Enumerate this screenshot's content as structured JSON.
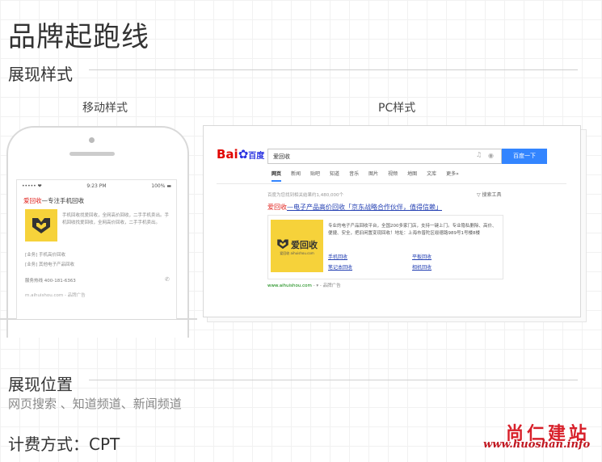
{
  "page": {
    "title": "品牌起跑线"
  },
  "sections": {
    "display_style": {
      "title": "展现样式"
    },
    "display_position": {
      "title": "展现位置",
      "value": "网页搜索 、知道频道、新闻频道"
    },
    "billing": {
      "label": "计费方式：CPT"
    }
  },
  "captions": {
    "mobile": "移动样式",
    "pc": "PC样式"
  },
  "mobile_preview": {
    "status_left": "••••• ❤",
    "time": "9:23 PM",
    "battery": "100% ▬",
    "ad_title_brand": "爱回收",
    "ad_title_rest": "—专注手机回收",
    "description": "手机回收找爱回收，全网高价回收，二手手机卖出。手机回收找爱回收，全网高价回收，二手手机卖出。",
    "link1": "[业务]  手机高价回收",
    "link2": "[业务]  其他电子产品回收",
    "phone": "服务热线  400-181-6363",
    "url": "m.aihuishou.com - 品牌广告"
  },
  "pc_preview": {
    "logo_red": "Bai",
    "logo_blue": "du",
    "logo_cn": "百度",
    "search_value": "爱回收",
    "search_button": "百度一下",
    "nav": [
      "网页",
      "新闻",
      "贴吧",
      "知道",
      "音乐",
      "图片",
      "视频",
      "地图",
      "文库",
      "更多»"
    ],
    "result_count": "百度为您找到相关结果约1,480,000个",
    "search_tools": "▽ 搜索工具",
    "ad_title_brand": "爱回收",
    "ad_title_rest": "—电子产品高价回收「京东战略合作伙伴，值得信赖」",
    "ad_logo_text": "爱回收",
    "ad_logo_sub": "爱回收 aihuishou.com",
    "ad_description": "专业的电子产品回收平台，全国200多家门店，支持一键上门。专业隐私删除、高价、便捷、安全，把旧闲置变现回收！地址：上海市普陀区绥德路989号1号楼8楼",
    "links": [
      "手机回收",
      "平板回收",
      "笔记本回收",
      "相机回收"
    ],
    "url_green": "www.aihuishou.com",
    "url_grey": " - ▾ - 品牌广告"
  },
  "watermark": {
    "cn": "尚仁建站",
    "url": "www.huoshan.info"
  },
  "colors": {
    "brand_red": "#e0211c",
    "search_blue": "#3385ff",
    "logo_yellow": "#f6d23a",
    "link_blue": "#2440b3"
  }
}
